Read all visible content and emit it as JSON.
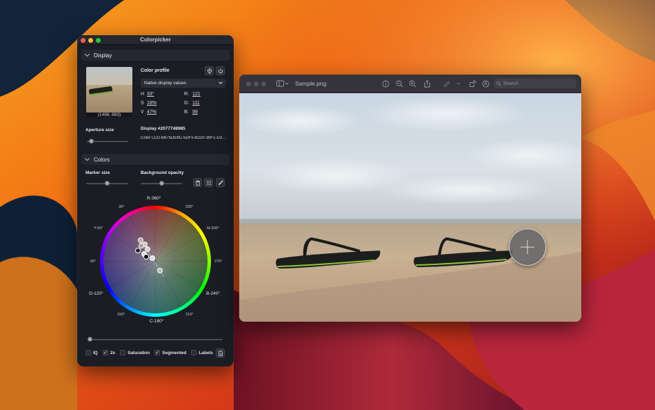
{
  "colorpicker": {
    "title": "Colorpicker",
    "display_section": {
      "title": "Display"
    },
    "thumbnail_coords": "(1498, 683)",
    "color_profile_label": "Color profile",
    "profile_select": {
      "value": "Native display values"
    },
    "hsv": {
      "h_label": "H",
      "h_value": "33°",
      "s_label": "S",
      "s_value": "18%",
      "v_label": "V",
      "v_value": "47%"
    },
    "rgb": {
      "r_label": "R:",
      "r_value": "121",
      "g_label": "G:",
      "g_value": "111",
      "b_label": "B:",
      "b_value": "99"
    },
    "aperture_label": "Aperture size",
    "display_id": "Display #2077748985",
    "display_name": "Color LCD-6B75DE6C-5DF5-B220-39F1-D3...",
    "colors_section": {
      "title": "Colors"
    },
    "marker_size_label": "Marker size",
    "background_opacity_label": "Background opacity",
    "sliders": {
      "aperture": 0.1,
      "marker_size": 0.5,
      "background_opacity": 0.5,
      "bottom": 0.02
    },
    "wheel_labels": {
      "top": "R-360°",
      "bottom": "C-180°",
      "left": "G-120°",
      "right": "B-240°",
      "d30": "30°",
      "d330": "330°",
      "d60": "Y-60°",
      "d300": "M-300°",
      "d90": "90°",
      "d270": "270°",
      "d150": "150°",
      "d210": "210°"
    },
    "options": {
      "iq_label": "IQ",
      "iq_checked": false,
      "x2_label": "2x",
      "x2_checked": true,
      "saturation_label": "Saturation",
      "saturation_checked": false,
      "segmented_label": "Segmented",
      "segmented_checked": true,
      "labels_label": "Labels",
      "labels_checked": false
    },
    "icons": [
      "pin-icon",
      "power-icon",
      "trash-icon",
      "grid-icon",
      "eyedropper-icon",
      "export-icon"
    ]
  },
  "preview": {
    "title": "Sample.png",
    "search_placeholder": "Search",
    "toolbar_icons": [
      "sidebar-icon",
      "info-icon",
      "zoom-out-icon",
      "zoom-in-icon",
      "share-icon",
      "markup-icon",
      "rotate-icon",
      "annotate-icon"
    ]
  }
}
